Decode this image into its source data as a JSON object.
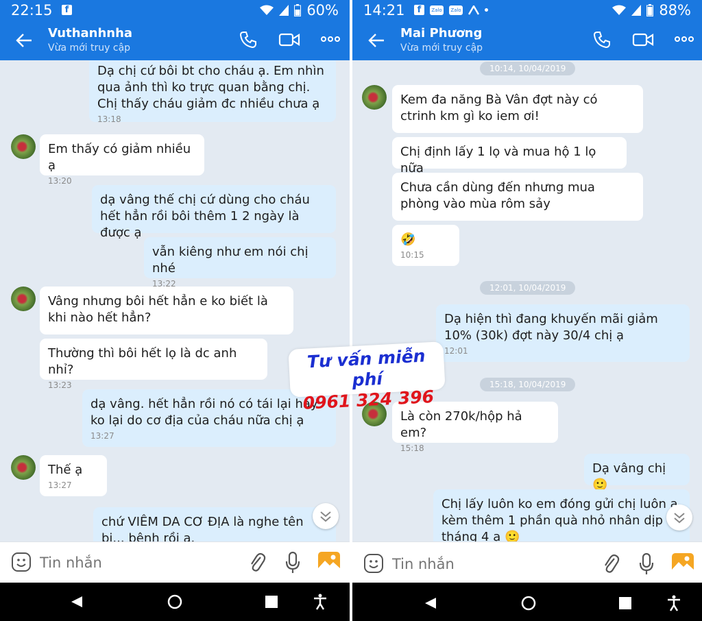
{
  "left": {
    "status": {
      "time": "22:15",
      "battery": "60%"
    },
    "header": {
      "name": "Vuthanhnha",
      "subtitle": "Vừa mới truy cập"
    },
    "messages": [
      {
        "text": "Dạ chị cứ bôi bt cho cháu ạ. Em nhìn qua ảnh thì ko trực quan bằng chị. Chị thấy cháu giảm đc nhiều chưa ạ",
        "time": "13:18"
      },
      {
        "text": "Em thấy có giảm nhiều ạ",
        "time": "13:20"
      },
      {
        "text": "dạ vâng thế chị cứ dùng cho cháu hết hẳn rồi bôi thêm 1 2 ngày là được ạ",
        "time": ""
      },
      {
        "text": "vẫn kiêng như em nói chị nhé",
        "time": "13:22"
      },
      {
        "text": "Vâng nhưng bôi hết hẳn e ko biết là khi nào hết hẳn?",
        "time": ""
      },
      {
        "text": "Thường thì bôi hết lọ là dc anh nhỉ?",
        "time": "13:23"
      },
      {
        "text": "dạ vâng. hết hẳn rồi nó có tái lại hay ko lại do cơ địa của cháu nữa chị ạ",
        "time": "13:27"
      },
      {
        "text": "Thế ạ",
        "time": "13:27"
      },
      {
        "text": "chứ VIÊM DA CƠ ĐỊA là nghe tên bi... bệnh rồi ạ.",
        "time": ""
      }
    ],
    "input": {
      "placeholder": "Tin nhắn"
    }
  },
  "right": {
    "status": {
      "time": "14:21",
      "battery": "88%"
    },
    "header": {
      "name": "Mai Phương",
      "subtitle": "Vừa mới truy cập"
    },
    "dates": [
      "10:14, 10/04/2019",
      "12:01, 10/04/2019",
      "15:18, 10/04/2019"
    ],
    "messages": [
      {
        "text": "Kem đa năng Bà Vân đợt này có ctrinh km gì ko iem ơi!",
        "time": ""
      },
      {
        "text": "Chị định lấy 1 lọ  và mua hộ 1 lọ nữa",
        "time": ""
      },
      {
        "text": "Chưa cần dùng đến nhưng mua phòng vào mùa rôm sảy",
        "time": ""
      },
      {
        "text": "🤣",
        "time": "10:15"
      },
      {
        "text": "Dạ hiện thì đang khuyến mãi giảm 10% (30k) đợt này 30/4 chị ạ",
        "time": "12:01"
      },
      {
        "text": "Là còn 270k/hộp hả em?",
        "time": "15:18"
      },
      {
        "text": "Dạ vâng chị 🙂",
        "time": ""
      },
      {
        "text": "Chị lấy luôn ko em đóng gửi chị luôn ạ kèm thêm 1 phần quà nhỏ nhân dịp tháng 4 a 🙂",
        "time": ""
      }
    ],
    "input": {
      "placeholder": "Tin nhắn"
    }
  },
  "watermark": {
    "line1": "Tư vấn miễn phí",
    "line2": "0961 324 396"
  },
  "icons": [
    "back-arrow-icon",
    "phone-icon",
    "video-icon",
    "more-icon",
    "sticker-icon",
    "attach-icon",
    "mic-icon",
    "image-icon",
    "chevron-down-icon",
    "nav-back-icon",
    "nav-home-icon",
    "nav-recents-icon",
    "accessibility-icon"
  ],
  "colors": {
    "header": "#1a78e0",
    "chat_bg": "#e3eaf2",
    "outgoing_bubble": "#dbeefd",
    "incoming_bubble": "#ffffff"
  }
}
